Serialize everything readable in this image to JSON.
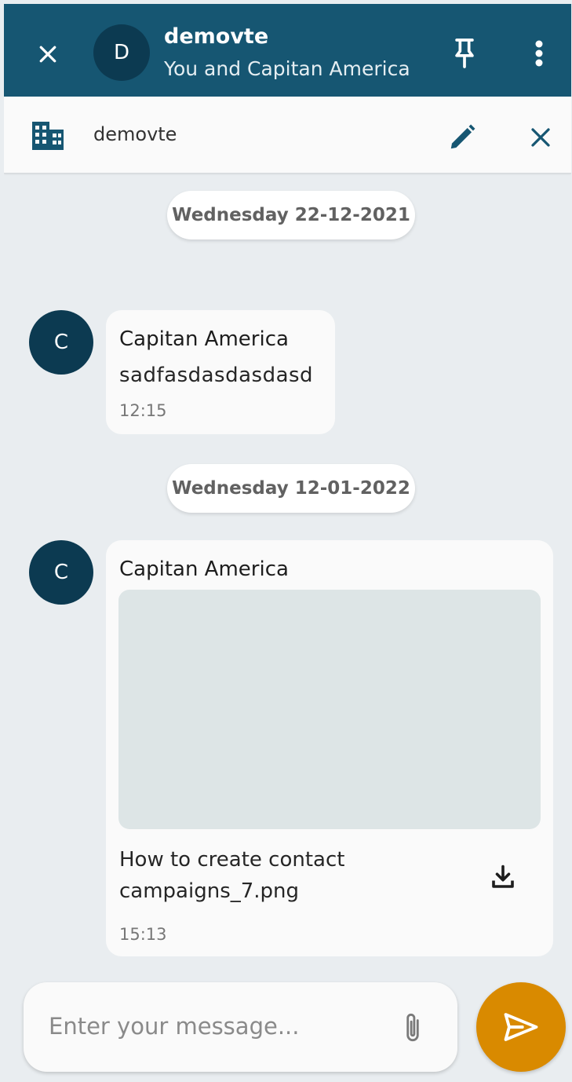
{
  "header": {
    "avatar_letter": "D",
    "title": "demovte",
    "subtitle": "You and Capitan America"
  },
  "context": {
    "label": "demovte"
  },
  "messages": [
    {
      "date": "Wednesday 22-12-2021",
      "avatar_letter": "C",
      "sender": "Capitan America",
      "text": "sadfasdasdasdasd",
      "time": "12:15"
    },
    {
      "date": "Wednesday 12-01-2022",
      "avatar_letter": "C",
      "sender": "Capitan America",
      "file_name_line1": "How to create contact",
      "file_name_line2": "campaigns_7.png",
      "time": "15:13"
    }
  ],
  "composer": {
    "placeholder": "Enter your message..."
  },
  "colors": {
    "header_bg": "#165672",
    "avatar_bg": "#0c3a51",
    "send_button": "#d98a00",
    "chat_bg": "#e9edf0"
  },
  "icons": [
    "close-icon",
    "pin-icon",
    "more-vert-icon",
    "building-icon",
    "edit-icon",
    "download-icon",
    "attach-icon",
    "send-icon"
  ]
}
